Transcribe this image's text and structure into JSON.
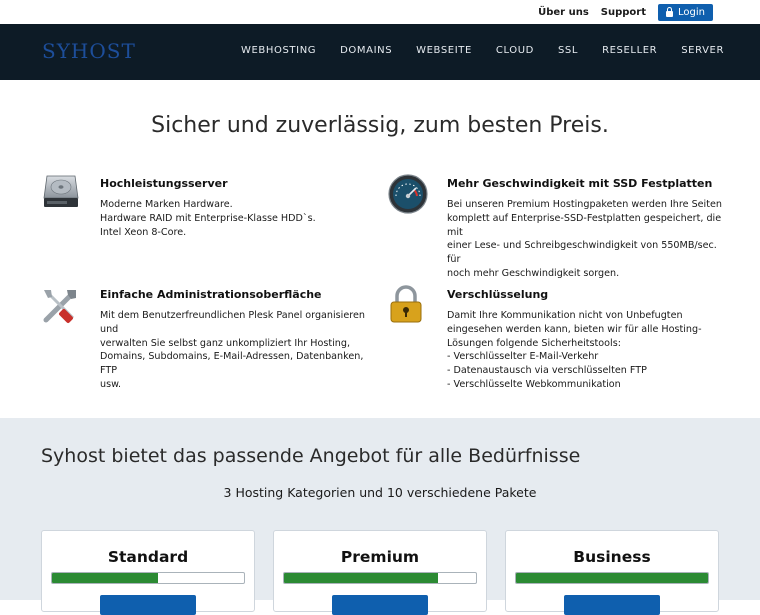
{
  "topbar": {
    "about": "Über uns",
    "support": "Support",
    "login": "Login"
  },
  "logo": "SYHOST",
  "nav": [
    "WEBHOSTING",
    "DOMAINS",
    "WEBSEITE",
    "CLOUD",
    "SSL",
    "RESELLER",
    "SERVER"
  ],
  "hero": {
    "title": "Sicher und zuverlässig, zum besten Preis."
  },
  "features": [
    {
      "title": "Hochleistungsserver",
      "text": "Moderne Marken Hardware.\nHardware RAID mit Enterprise-Klasse HDD`s.\nIntel Xeon 8-Core.",
      "icon": "hard-drive-icon"
    },
    {
      "title": "Mehr Geschwindigkeit mit SSD Festplatten",
      "text": "Bei unseren Premium Hostingpaketen werden Ihre Seiten\nkomplett auf Enterprise-SSD-Festplatten gespeichert, die mit\neiner Lese- und Schreibgeschwindigkeit von 550MB/sec. für\nnoch mehr Geschwindigkeit sorgen.",
      "icon": "speedometer-icon"
    },
    {
      "title": "Einfache Administrationsoberfläche",
      "text": "Mit dem Benutzerfreundlichen Plesk Panel organisieren und\nverwalten Sie selbst ganz unkompliziert Ihr Hosting,\nDomains, Subdomains, E-Mail-Adressen, Datenbanken, FTP\nusw.",
      "icon": "tools-icon"
    },
    {
      "title": "Verschlüsselung",
      "text": "Damit Ihre Kommunikation nicht von Unbefugten\neingesehen werden kann, bieten wir für alle Hosting-\nLösungen folgende Sicherheitstools:\n- Verschlüsselter E-Mail-Verkehr\n- Datenaustausch via verschlüsselten FTP\n- Verschlüsselte Webkommunikation",
      "icon": "padlock-icon"
    }
  ],
  "offers": {
    "title": "Syhost bietet das passende Angebot für alle Bedürfnisse",
    "subtitle": "3 Hosting Kategorien und 10 verschiedene Pakete",
    "plans": [
      {
        "name": "Standard",
        "level": 0.55
      },
      {
        "name": "Premium",
        "level": 0.8
      },
      {
        "name": "Business",
        "level": 1.0
      }
    ]
  },
  "colors": {
    "nav_bg": "#0d1b26",
    "accent_blue": "#0f5fae",
    "bar_green": "#2b8a33",
    "section_bg": "#e6ebf0"
  }
}
